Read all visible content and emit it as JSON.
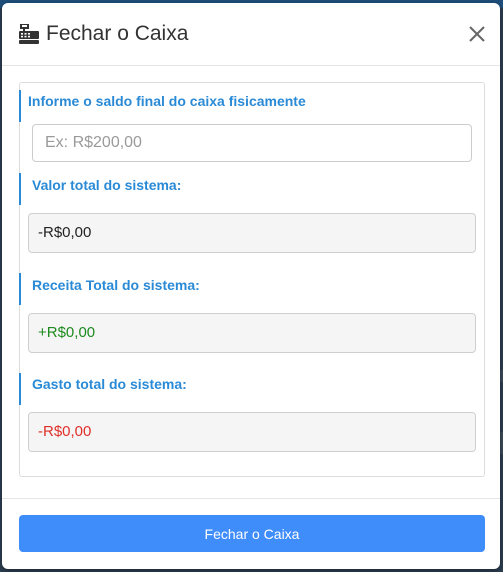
{
  "modal": {
    "title": "Fechar o Caixa",
    "icon": "cash-register-icon",
    "close_icon": "close-icon"
  },
  "form": {
    "final_balance_label": "Informe o saldo final do caixa fisicamente",
    "final_balance_placeholder": "Ex: R$200,00",
    "final_balance_value": "",
    "system_total_label": "Valor total do sistema:",
    "system_total_value": "-R$0,00",
    "system_revenue_label": "Receita Total do sistema:",
    "system_revenue_value": "+R$0,00",
    "system_expense_label": "Gasto total do sistema:",
    "system_expense_value": "-R$0,00"
  },
  "footer": {
    "submit_label": "Fechar o Caixa"
  },
  "colors": {
    "accent": "#2a8ad6",
    "button": "#3f8cfb",
    "revenue": "#1e8b1e",
    "expense": "#e0302a",
    "neutral": "#222222"
  }
}
